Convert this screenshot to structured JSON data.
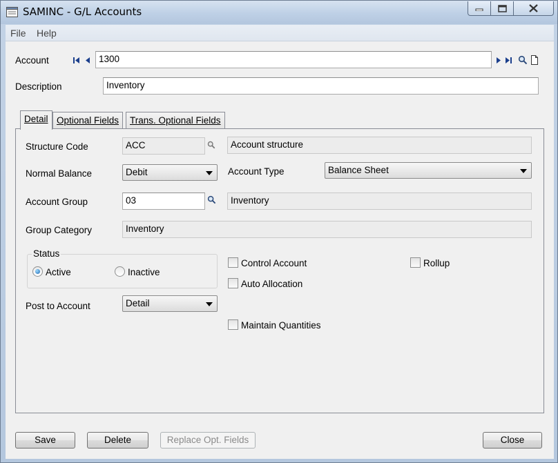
{
  "window": {
    "title": "SAMINC - G/L Accounts",
    "icons": {
      "app": "app-window-icon",
      "minimize": "minimize-icon",
      "maximize": "maximize-icon",
      "close": "close-icon"
    }
  },
  "menu": {
    "file": "File",
    "help": "Help"
  },
  "account": {
    "label": "Account",
    "value": "1300",
    "nav_icons": [
      "first-record-icon",
      "previous-record-icon",
      "next-record-icon",
      "last-record-icon",
      "finder-icon",
      "new-document-icon"
    ]
  },
  "description": {
    "label": "Description",
    "value": "Inventory"
  },
  "tabs": [
    {
      "label": "Detail",
      "active": true
    },
    {
      "label": "Optional Fields",
      "active": false
    },
    {
      "label": "Trans. Optional Fields",
      "active": false
    }
  ],
  "detail": {
    "structure_code": {
      "label": "Structure Code",
      "value": "ACC",
      "description": "Account structure"
    },
    "normal_balance": {
      "label": "Normal Balance",
      "value": "Debit"
    },
    "account_type": {
      "label": "Account Type",
      "value": "Balance Sheet"
    },
    "account_group": {
      "label": "Account Group",
      "value": "03",
      "description": "Inventory"
    },
    "group_category": {
      "label": "Group Category",
      "value": "Inventory"
    },
    "status": {
      "label": "Status",
      "options": [
        "Active",
        "Inactive"
      ],
      "selected": "Active"
    },
    "post_to_account": {
      "label": "Post to Account",
      "value": "Detail"
    },
    "checkboxes": {
      "control_account": {
        "label": "Control Account",
        "checked": false
      },
      "rollup": {
        "label": "Rollup",
        "checked": false
      },
      "auto_allocation": {
        "label": "Auto Allocation",
        "checked": false
      },
      "maintain_quantities": {
        "label": "Maintain Quantities",
        "checked": false
      }
    }
  },
  "buttons": {
    "save": "Save",
    "delete": "Delete",
    "replace_opt_fields": "Replace Opt. Fields",
    "close": "Close"
  }
}
